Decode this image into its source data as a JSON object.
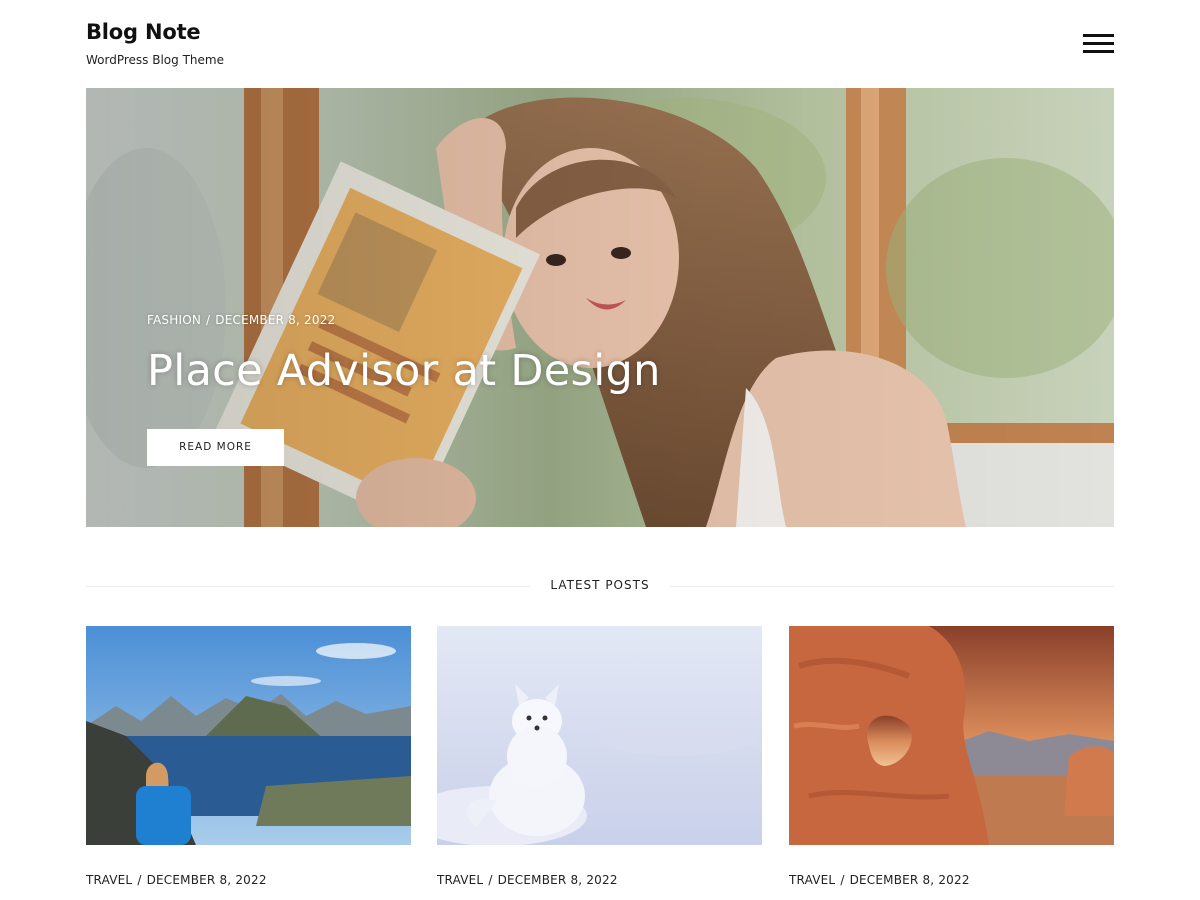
{
  "site": {
    "title": "Blog Note",
    "tagline": "WordPress Blog Theme"
  },
  "header": {
    "menu_icon": "hamburger-menu-icon"
  },
  "hero": {
    "category": "FASHION",
    "separator": "/",
    "date": "DECEMBER 8, 2022",
    "title": "Place Advisor at Design",
    "button_label": "READ MORE"
  },
  "latest": {
    "heading": "LATEST POSTS"
  },
  "posts": [
    {
      "category": "TRAVEL",
      "separator": "/",
      "date": "DECEMBER 8, 2022"
    },
    {
      "category": "TRAVEL",
      "separator": "/",
      "date": "DECEMBER 8, 2022"
    },
    {
      "category": "TRAVEL",
      "separator": "/",
      "date": "DECEMBER 8, 2022"
    }
  ],
  "colors": {
    "text": "#111111",
    "background": "#ffffff",
    "button_background": "#ffffff"
  }
}
